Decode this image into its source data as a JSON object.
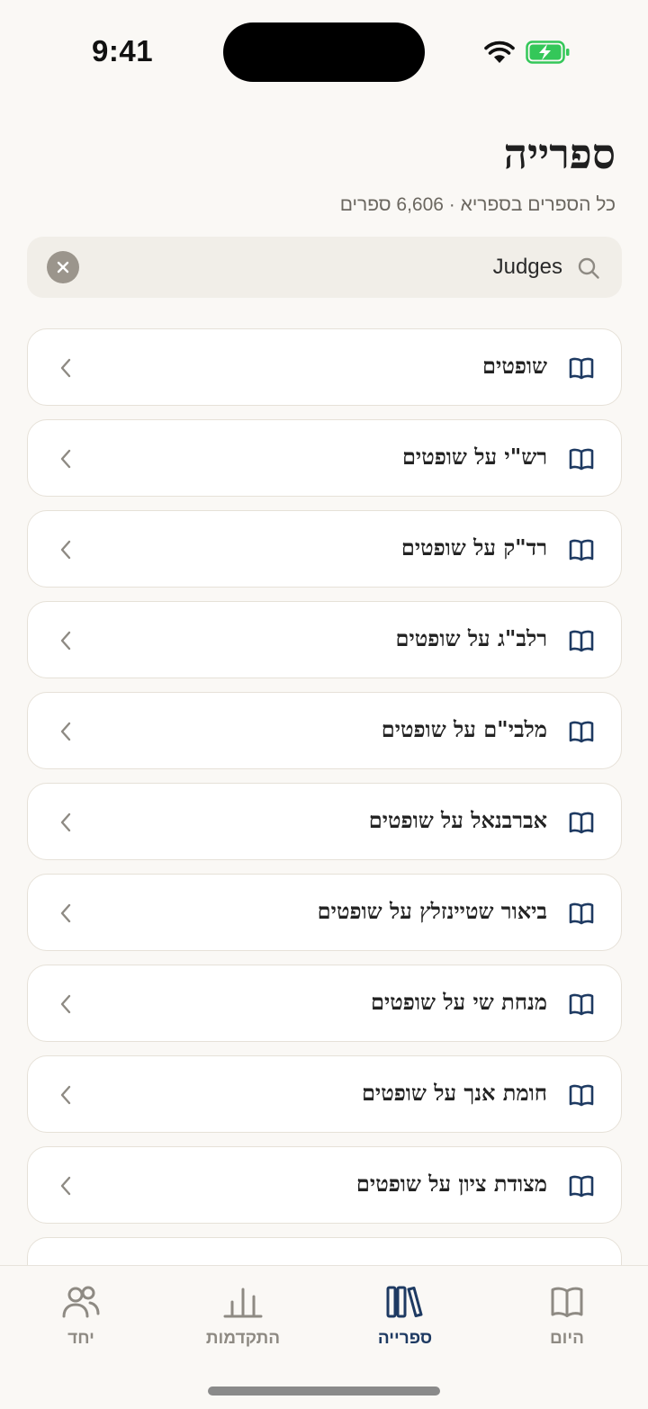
{
  "status_bar": {
    "time": "9:41"
  },
  "header": {
    "title": "ספרייה",
    "subtitle": "כל הספרים בספריא · 6,606 ספרים"
  },
  "search": {
    "value": "Judges",
    "placeholder": ""
  },
  "results": [
    {
      "label": "שופטים",
      "icon": "book-icon"
    },
    {
      "label": "רש\"י על שופטים",
      "icon": "book-icon"
    },
    {
      "label": "רד\"ק על שופטים",
      "icon": "book-icon"
    },
    {
      "label": "רלב\"ג על שופטים",
      "icon": "book-icon"
    },
    {
      "label": "מלבי\"ם על שופטים",
      "icon": "book-icon"
    },
    {
      "label": "אברבנאל על שופטים",
      "icon": "book-icon"
    },
    {
      "label": "ביאור שטיינזלץ על שופטים",
      "icon": "book-icon"
    },
    {
      "label": "מנחת שי על שופטים",
      "icon": "book-icon"
    },
    {
      "label": "חומת אנך על שופטים",
      "icon": "book-icon"
    },
    {
      "label": "מצודת ציון על שופטים",
      "icon": "book-icon"
    },
    {
      "label": "",
      "icon": "book-icon"
    }
  ],
  "tabs": [
    {
      "label": "היום",
      "icon": "open-book-icon",
      "active": false
    },
    {
      "label": "ספרייה",
      "icon": "library-icon",
      "active": true
    },
    {
      "label": "התקדמות",
      "icon": "bar-chart-icon",
      "active": false
    },
    {
      "label": "יחד",
      "icon": "people-icon",
      "active": false
    }
  ],
  "colors": {
    "accent": "#1e3a62",
    "background": "#faf8f5",
    "battery": "#34c759",
    "inactive_tab": "#8e8a83"
  }
}
